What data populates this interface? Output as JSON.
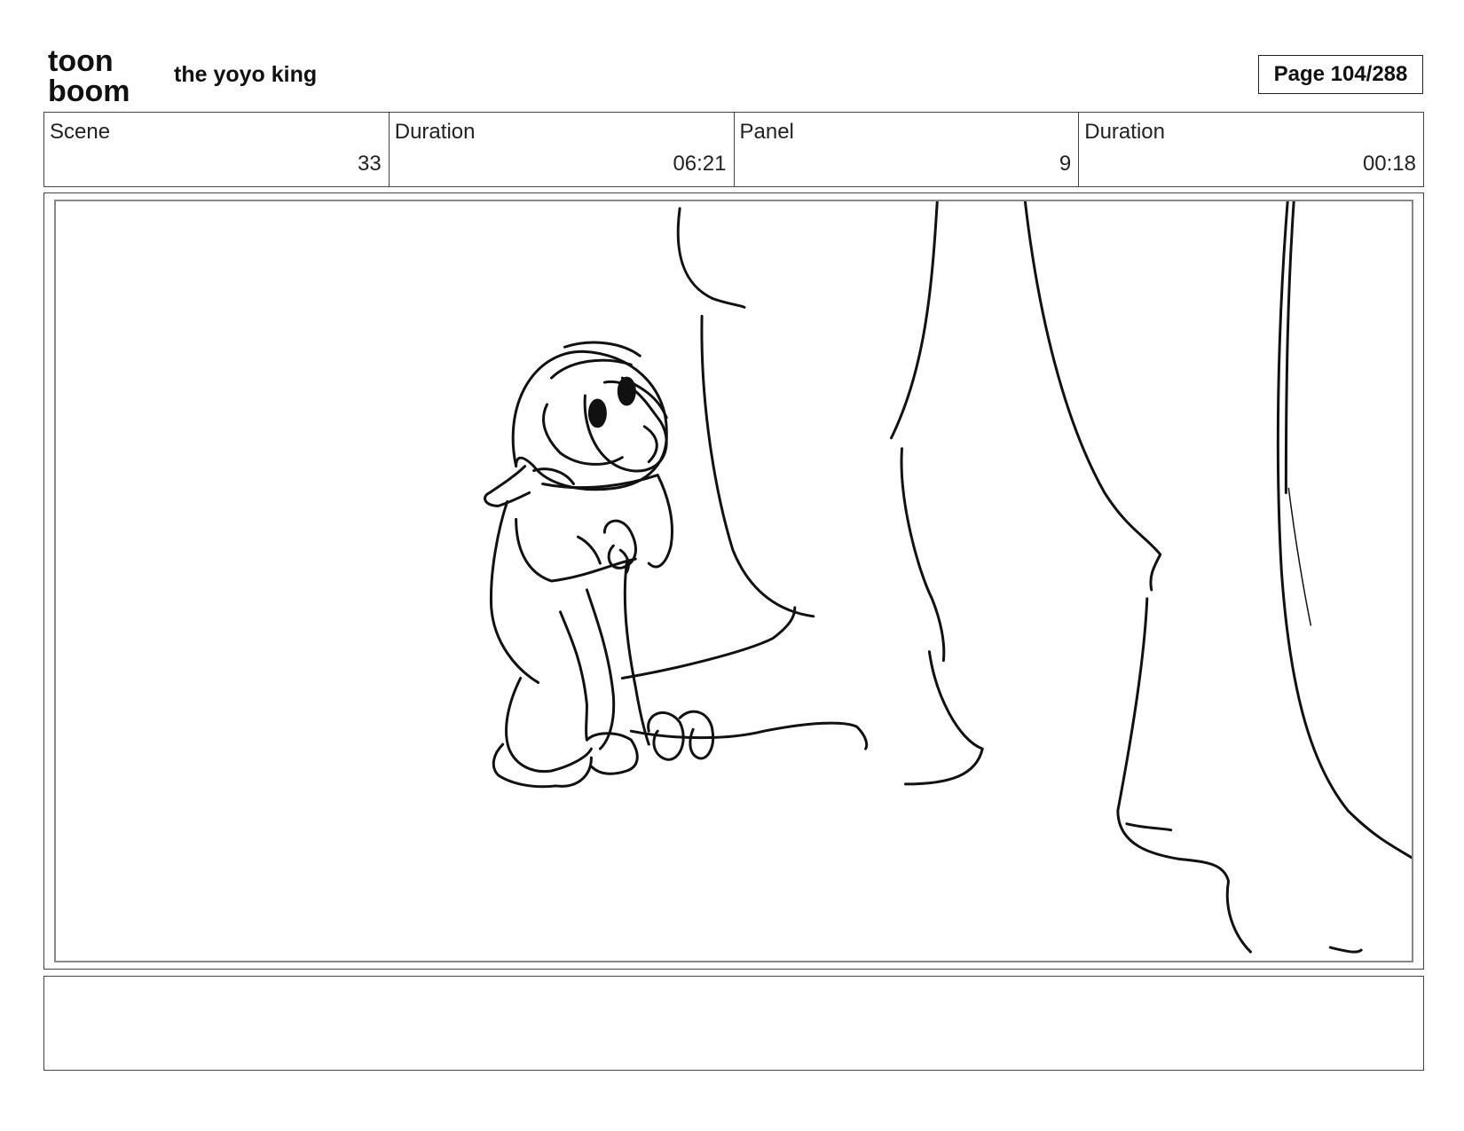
{
  "header": {
    "logo_line1": "toon",
    "logo_line2": "boom",
    "project_title": "the yoyo king",
    "page_label": "Page 104/288"
  },
  "info": {
    "scene_label": "Scene",
    "scene_value": "33",
    "scene_duration_label": "Duration",
    "scene_duration_value": "06:21",
    "panel_label": "Panel",
    "panel_value": "9",
    "panel_duration_label": "Duration",
    "panel_duration_value": "00:18"
  },
  "notes": {
    "text": ""
  },
  "colors": {
    "ink": "#111111",
    "frame": "#888888",
    "border": "#444444"
  }
}
